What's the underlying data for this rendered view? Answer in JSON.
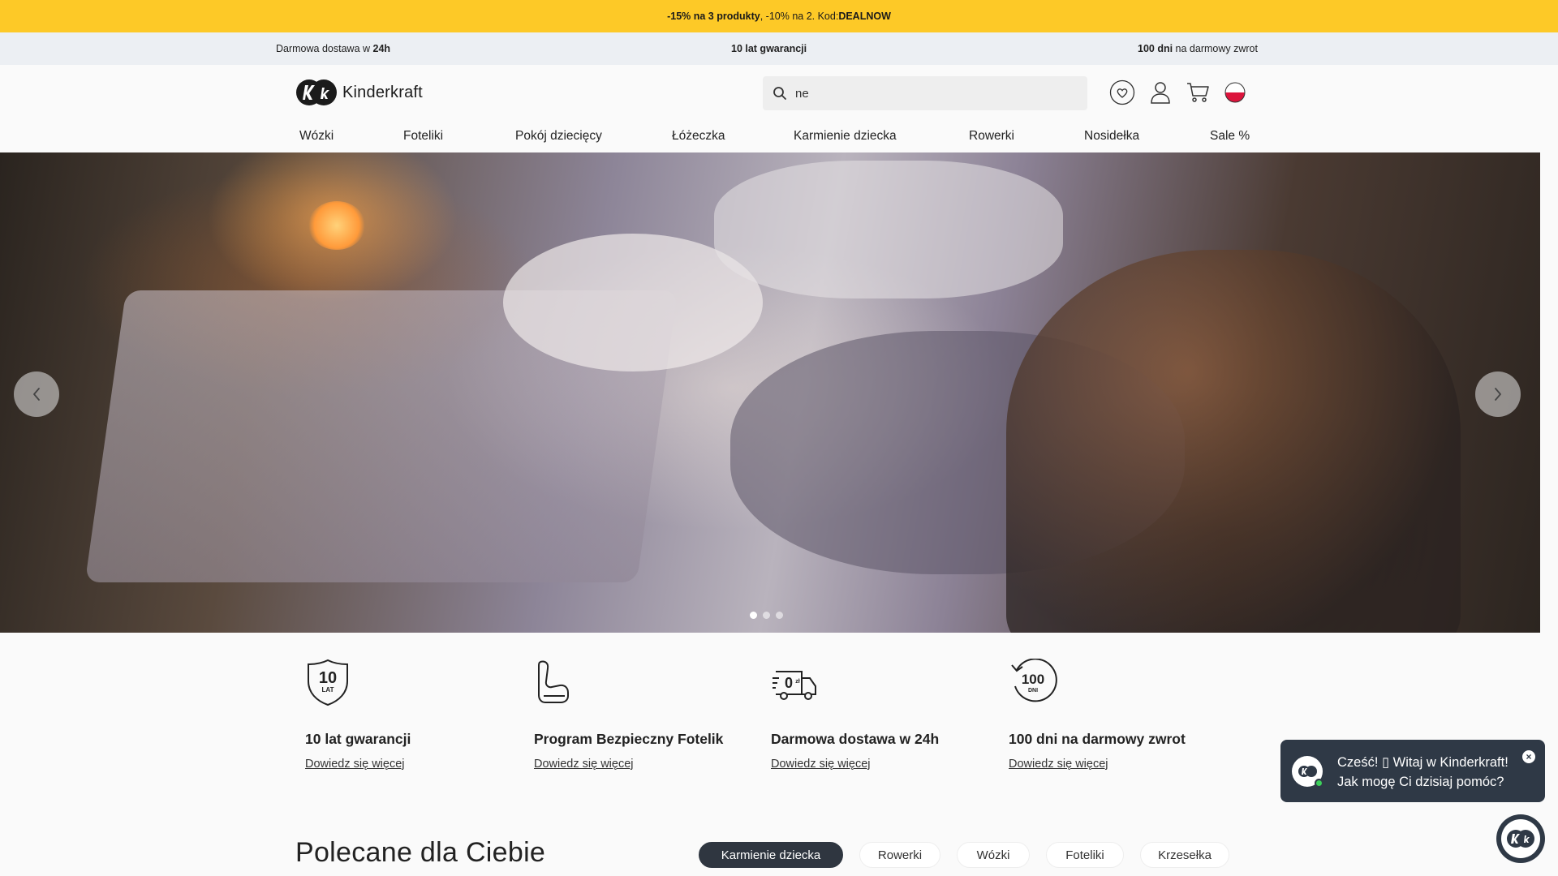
{
  "promo": {
    "part1": "-15% na 3 produkty",
    "part2": ", -10% na 2. Kod: ",
    "code": "DEALNOW"
  },
  "usp_bar": {
    "delivery_prefix": "Darmowa dostawa w ",
    "delivery_bold": "24h",
    "warranty": "10 lat gwarancji",
    "returns_bold": "100 dni",
    "returns_suffix": " na darmowy zwrot"
  },
  "header": {
    "logo_text": "Kinderkraft",
    "search_value": "ne",
    "icons": [
      "heart-icon",
      "user-icon",
      "cart-icon",
      "poland-flag-icon"
    ]
  },
  "nav": {
    "items": [
      "Wózki",
      "Foteliki",
      "Pokój dziecięcy",
      "Łóżeczka",
      "Karmienie dziecka",
      "Rowerki",
      "Nosidełka",
      "Sale %"
    ]
  },
  "carousel": {
    "slide_count": 3,
    "active_index": 0
  },
  "features": [
    {
      "icon": "shield-10-years-icon",
      "icon_text_big": "10",
      "icon_text_small": "LAT",
      "title": "10 lat gwarancji",
      "link": "Dowiedz się więcej"
    },
    {
      "icon": "car-seat-icon",
      "title": "Program Bezpieczny Fotelik",
      "link": "Dowiedz się więcej"
    },
    {
      "icon": "delivery-van-icon",
      "icon_text_big": "0",
      "icon_text_small": "zł",
      "title": "Darmowa dostawa w 24h",
      "link": "Dowiedz się więcej"
    },
    {
      "icon": "100-days-return-icon",
      "icon_text_big": "100",
      "icon_text_small": "DNI",
      "title": "100 dni na darmowy zwrot",
      "link": "Dowiedz się więcej"
    }
  ],
  "recommended": {
    "title": "Polecane dla Ciebie",
    "chips": [
      "Karmienie dziecka",
      "Rowerki",
      "Wózki",
      "Foteliki",
      "Krzesełka"
    ],
    "active_chip": "Karmienie dziecka"
  },
  "chat": {
    "line1": "Cześć! ▯ Witaj w Kinderkraft!",
    "line2": "Jak mogę Ci dzisiaj pomóc?"
  },
  "colors": {
    "promo_bg": "#fdc927",
    "usp_bg": "#eceff3",
    "chat_bg": "#2f3946",
    "active_chip_bg": "#2f3640"
  }
}
